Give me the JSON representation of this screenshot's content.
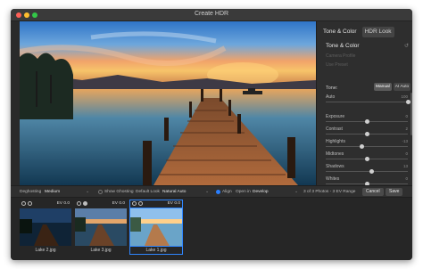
{
  "window": {
    "title": "Create HDR"
  },
  "panel": {
    "tabs": [
      {
        "label": "Tone & Color",
        "active": true
      },
      {
        "label": "HDR Look",
        "active": false
      }
    ],
    "section_title": "Tone & Color",
    "disabled_rows": [
      "Camera Profile",
      "Use Preset"
    ],
    "tone": {
      "label": "Tone:",
      "buttons": [
        "Manual",
        "AI Auto"
      ],
      "active_button": "Manual"
    },
    "sliders": [
      {
        "label": "Auto",
        "value": "100",
        "level": 1.0
      },
      {
        "label": "Exposure",
        "value": "0",
        "level": 0.5
      },
      {
        "label": "Contrast",
        "value": "2",
        "level": 0.51
      },
      {
        "label": "Highlights",
        "value": "-13",
        "level": 0.44
      },
      {
        "label": "Midtones",
        "value": "0",
        "level": 0.5
      },
      {
        "label": "Shadows",
        "value": "13",
        "level": 0.56
      },
      {
        "label": "Whites",
        "value": "0",
        "level": 0.5
      },
      {
        "label": "Blacks",
        "value": "-10",
        "level": 0.45
      }
    ]
  },
  "toolbar": {
    "deghosting_label": "Deghosting",
    "deghosting_value": "Medium",
    "show_ghosting_label": "Show Ghosting",
    "default_look_label": "Default Look",
    "default_look_value": "Natural Auto",
    "align_label": "Align",
    "open_in_label": "Open in",
    "open_in_value": "Develop",
    "status": "3 of 3 Photos - 3 EV Range",
    "cancel_label": "Cancel",
    "save_label": "Save"
  },
  "filmstrip": [
    {
      "name": "Lake 2.jpg",
      "ev": "EV 0.0",
      "selected": false
    },
    {
      "name": "Lake 3.jpg",
      "ev": "EV 0.0",
      "selected": false
    },
    {
      "name": "Lake 1.jpg",
      "ev": "EV 0.0",
      "selected": true
    }
  ],
  "colors": {
    "accent": "#2f86ff",
    "background": "#2a2a2a",
    "panel": "#2e2e2e"
  }
}
